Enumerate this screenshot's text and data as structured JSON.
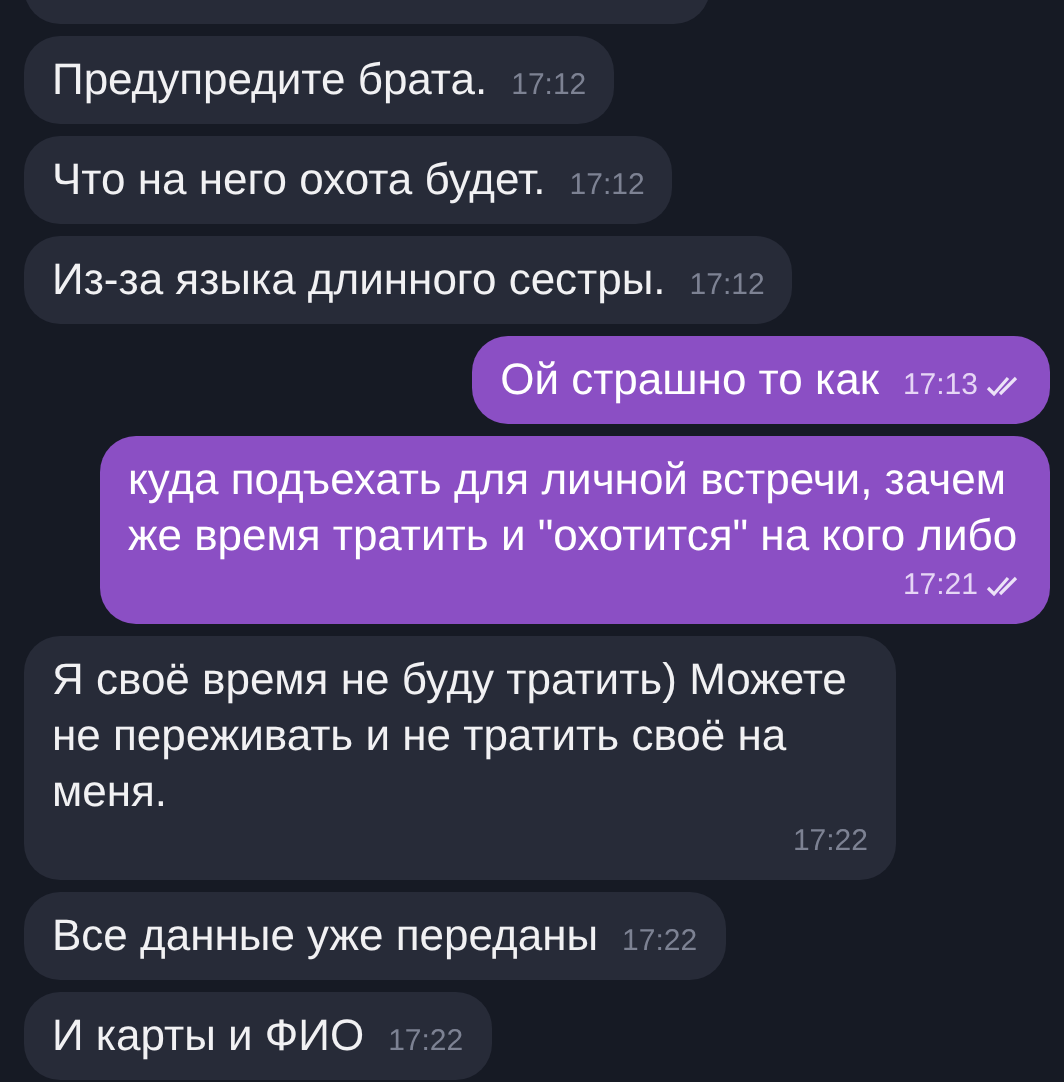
{
  "messages": [
    {
      "kind": "incoming",
      "text": "Предупредите брата.",
      "time": "17:12"
    },
    {
      "kind": "incoming",
      "text": "Что на него охота будет.",
      "time": "17:12"
    },
    {
      "kind": "incoming",
      "text": "Из-за языка длинного сестры.",
      "time": "17:12"
    },
    {
      "kind": "outgoing",
      "text": "Ой страшно то как",
      "time": "17:13",
      "read": true
    },
    {
      "kind": "outgoing",
      "text": "куда подъехать для личной встречи, зачем же время тратить и \"охотится\" на кого либо",
      "time": "17:21",
      "read": true
    },
    {
      "kind": "incoming",
      "text": "Я своё время не буду тратить) Можете не переживать и не тратить своё на меня.",
      "time": "17:22"
    },
    {
      "kind": "incoming",
      "text": "Все данные уже переданы",
      "time": "17:22"
    },
    {
      "kind": "incoming",
      "text": "И карты и ФИО",
      "time": "17:22"
    }
  ]
}
